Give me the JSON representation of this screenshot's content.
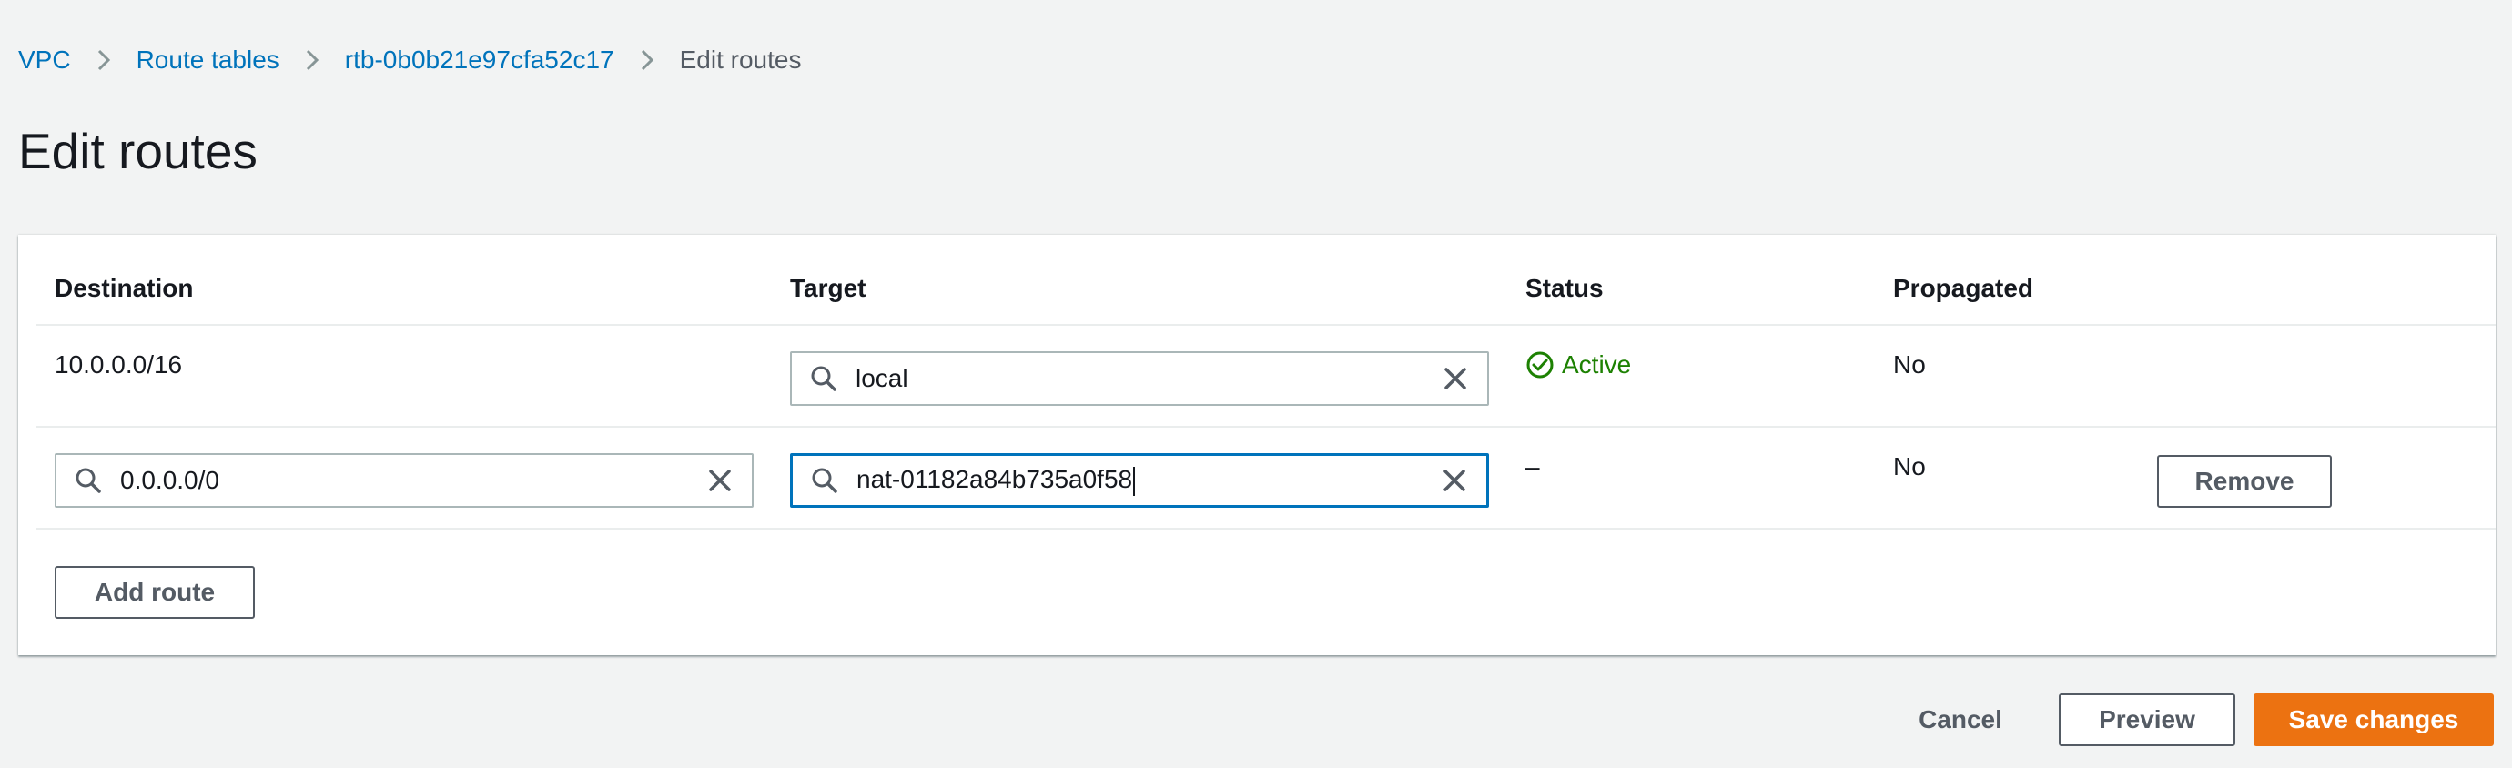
{
  "breadcrumb": {
    "items": [
      {
        "label": "VPC"
      },
      {
        "label": "Route tables"
      },
      {
        "label": "rtb-0b0b21e97cfa52c17"
      }
    ],
    "current": "Edit routes"
  },
  "page": {
    "title": "Edit routes"
  },
  "table": {
    "headers": {
      "destination": "Destination",
      "target": "Target",
      "status": "Status",
      "propagated": "Propagated"
    },
    "rows": [
      {
        "destination": "10.0.0.0/16",
        "target": "local",
        "status": "Active",
        "propagated": "No"
      },
      {
        "destination": "0.0.0.0/0",
        "target": "nat-01182a84b735a0f58",
        "status": "–",
        "propagated": "No",
        "remove_label": "Remove"
      }
    ],
    "add_route_label": "Add route"
  },
  "footer": {
    "cancel_label": "Cancel",
    "preview_label": "Preview",
    "save_label": "Save changes"
  },
  "colors": {
    "link": "#0073bb",
    "active_status": "#1d8102",
    "primary_button": "#ec7211",
    "focus_border": "#0073bb"
  },
  "icons": {
    "breadcrumb_separator": "chevron-right-icon",
    "input_search": "search-icon",
    "input_clear": "clear-icon",
    "status": "check-circle-icon"
  }
}
